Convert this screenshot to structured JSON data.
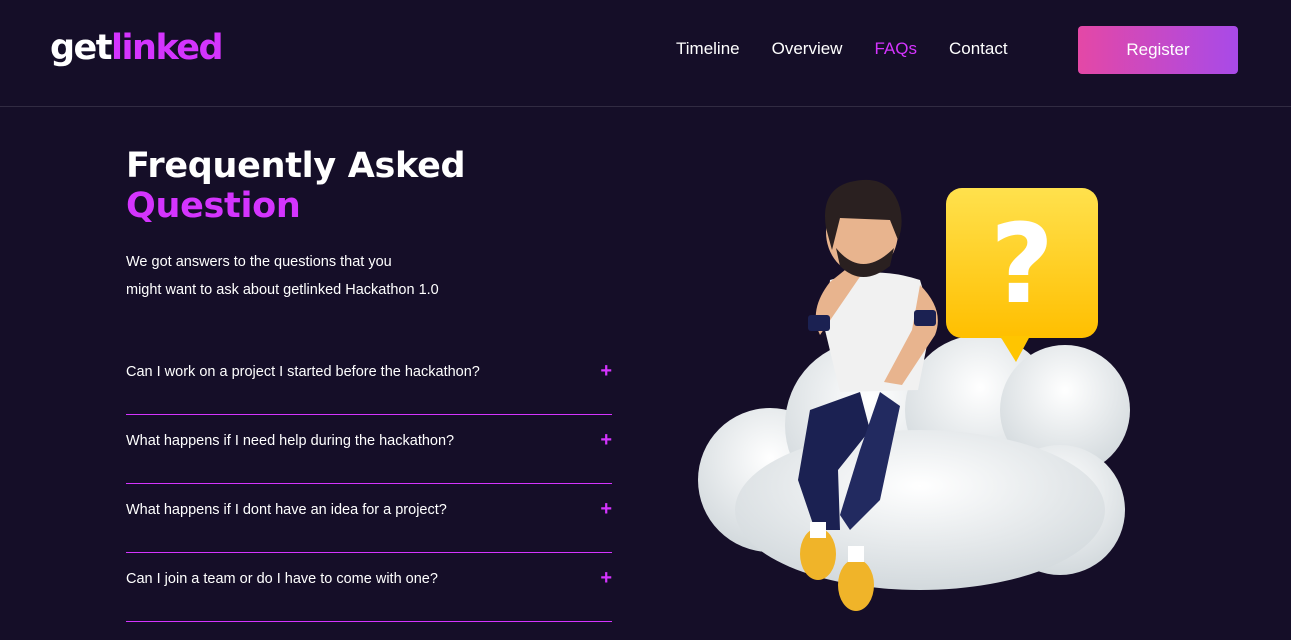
{
  "header": {
    "logo_part1": "get",
    "logo_part2": "linked",
    "nav": [
      {
        "label": "Timeline"
      },
      {
        "label": "Overview"
      },
      {
        "label": "FAQs",
        "active": true
      },
      {
        "label": "Contact"
      }
    ],
    "register_label": "Register"
  },
  "main": {
    "title_line1": "Frequently Asked",
    "title_line2": "Question",
    "subtitle_line1": "We got answers to the questions that you",
    "subtitle_line2": "might want to ask about getlinked Hackathon 1.0",
    "faqs": [
      {
        "question": "Can I work on a project I started before the hackathon?",
        "toggle": "+"
      },
      {
        "question": "What happens if I need help during the hackathon?",
        "toggle": "+"
      },
      {
        "question": "What happens if I dont have an idea for a project?",
        "toggle": "+"
      },
      {
        "question": "Can I join a team or do I have to come with one?",
        "toggle": "+"
      }
    ],
    "illustration_mark": "?"
  },
  "colors": {
    "background": "#150e28",
    "accent": "#d434fe",
    "button_gradient_start": "#e448a6",
    "button_gradient_end": "#a84ae8"
  }
}
